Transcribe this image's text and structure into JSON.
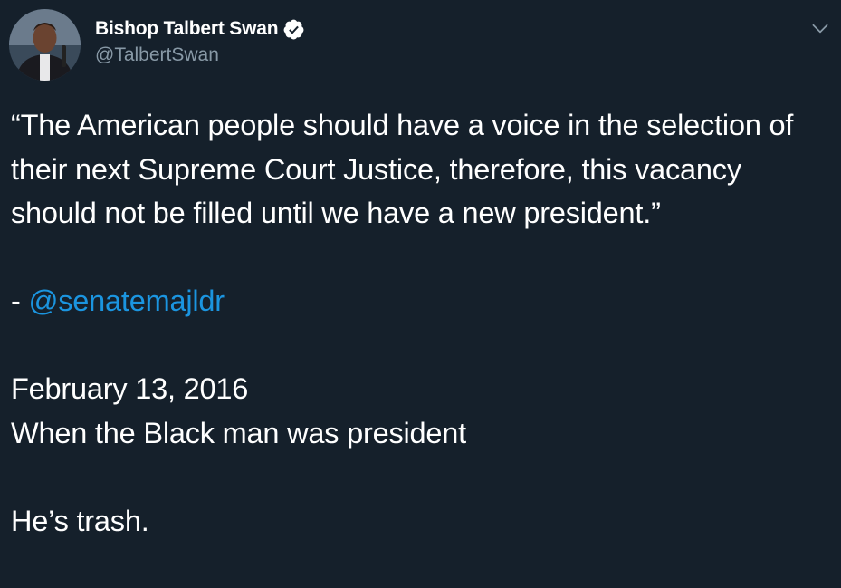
{
  "tweet": {
    "author": {
      "display_name": "Bishop Talbert Swan",
      "handle": "@TalbertSwan",
      "verified": true
    },
    "quote": "“The American people should have a voice in the selection of their next Supreme Court Justice, therefore, this vacancy should not be filled until we have a new president.”",
    "attribution_prefix": "- ",
    "mention": "@senatemajldr",
    "date_line": "February 13, 2016",
    "comment_line": "When the Black man was president",
    "closing_line": "He’s trash."
  },
  "colors": {
    "background": "#15202b",
    "text": "#ffffff",
    "secondary_text": "#8899a6",
    "link": "#1b95e0"
  },
  "icons": {
    "verified": "verified-badge-icon",
    "menu": "chevron-down-icon"
  }
}
